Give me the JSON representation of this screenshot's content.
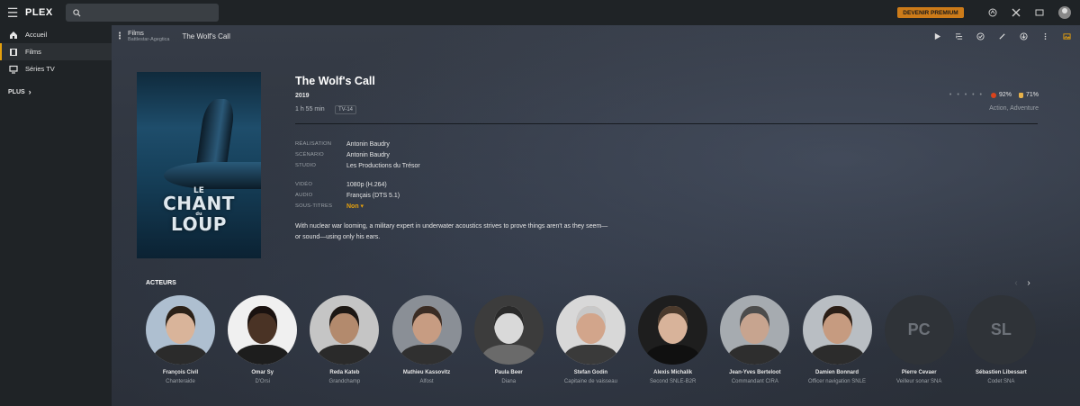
{
  "topbar": {
    "logo_text": "PLEX",
    "search_placeholder": "",
    "premium_label": "DEVENIR PREMIUM",
    "icons": [
      "activity-icon",
      "settings-icon",
      "cast-icon",
      "avatar"
    ]
  },
  "sidebar": {
    "items": [
      {
        "label": "Accueil",
        "icon": "home-icon",
        "active": false
      },
      {
        "label": "Films",
        "icon": "film-icon",
        "active": true
      },
      {
        "label": "Séries TV",
        "icon": "tv-icon",
        "active": false
      }
    ],
    "more_label": "PLUS"
  },
  "breadcrumb": {
    "library": "Films",
    "server": "Battlestar-Agegtica",
    "title": "The Wolf's Call"
  },
  "actions": [
    "play-icon",
    "add-to-list-icon",
    "watched-icon",
    "edit-icon",
    "download-icon",
    "more-icon",
    "image-icon"
  ],
  "movie": {
    "title": "The Wolf's Call",
    "year": "2019",
    "duration": "1 h 55 min",
    "content_rating": "TV-14",
    "rating_critics": "92%",
    "rating_audience": "71%",
    "genres": "Action, Adventure",
    "poster": {
      "line1": "LE",
      "line2": "CHANT",
      "line3": "du",
      "line4": "LOUP"
    },
    "details": {
      "direction_label": "RÉALISATION",
      "direction": "Antonin Baudry",
      "writing_label": "SCÉNARIO",
      "writing": "Antonin Baudry",
      "studio_label": "STUDIO",
      "studio": "Les Productions du Trésor",
      "video_label": "VIDÉO",
      "video": "1080p (H.264)",
      "audio_label": "AUDIO",
      "audio": "Français (DTS 5.1)",
      "subtitles_label": "SOUS-TITRES",
      "subtitles": "Non ▾"
    },
    "summary": "With nuclear war looming, a military expert in underwater acoustics strives to prove things aren't as they seem—or sound—using only his ears."
  },
  "cast": {
    "header": "ACTEURS",
    "actors": [
      {
        "name": "François Civil",
        "role": "Chanteraide",
        "skin": "#d9b49a",
        "hair": "#2b2118",
        "bg": "#aebfd0",
        "shirt": "#2b2b2b"
      },
      {
        "name": "Omar Sy",
        "role": "D'Orsi",
        "skin": "#4a3325",
        "hair": "#1a1210",
        "bg": "#f0f0f0",
        "shirt": "#1d1d1d"
      },
      {
        "name": "Reda Kateb",
        "role": "Grandchamp",
        "skin": "#b38a6d",
        "hair": "#1c1714",
        "bg": "#c5c5c5",
        "shirt": "#2a2a2a"
      },
      {
        "name": "Mathieu Kassovitz",
        "role": "Alfost",
        "skin": "#c79c82",
        "hair": "#3a2c24",
        "bg": "#8a8f96",
        "shirt": "#303030"
      },
      {
        "name": "Paula Beer",
        "role": "Diana",
        "skin": "#d9d9d9",
        "hair": "#2a2a2a",
        "bg": "#3c3c3c",
        "shirt": "#6a6a6a"
      },
      {
        "name": "Stefan Godin",
        "role": "Capitaine de vaisseau",
        "skin": "#d2a58b",
        "hair": "#c8c8c8",
        "bg": "#d8d8d8",
        "shirt": "#3a3a3a"
      },
      {
        "name": "Alexis Michalik",
        "role": "Second SNLE-B2R",
        "skin": "#d8b39a",
        "hair": "#4b3a2c",
        "bg": "#1e1e1e",
        "shirt": "#101010"
      },
      {
        "name": "Jean-Yves Berteloot",
        "role": "Commandant CIRA",
        "skin": "#c7a48f",
        "hair": "#4c4c4c",
        "bg": "#a6abb0",
        "shirt": "#2e2e2e"
      },
      {
        "name": "Damien Bonnard",
        "role": "Officer navigation SNLE",
        "skin": "#c69b80",
        "hair": "#2a1e16",
        "bg": "#b9bec3",
        "shirt": "#2c2c2c"
      },
      {
        "name": "Pierre Cevaer",
        "role": "Veilleur sonar SNA",
        "initials": "PC"
      },
      {
        "name": "Sébastien Libessart",
        "role": "Codet SNA",
        "initials": "SL"
      }
    ]
  },
  "colors": {
    "accent": "#e5a00d",
    "premium": "#cc7b19",
    "topbar": "#1f2326"
  }
}
